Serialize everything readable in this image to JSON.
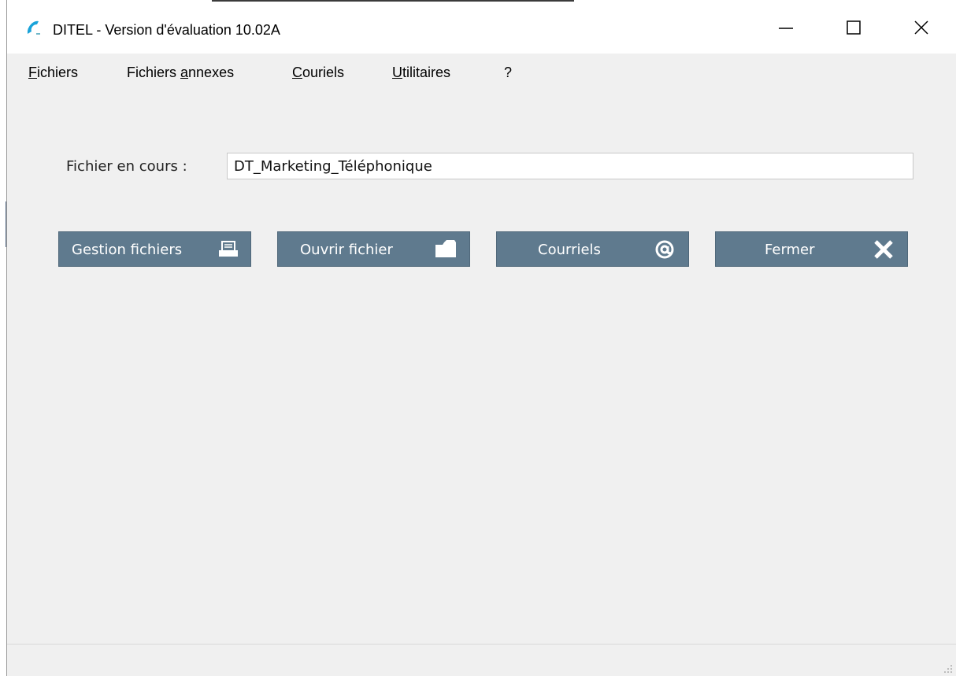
{
  "window": {
    "title": "DITEL - Version d'évaluation 10.02A",
    "app_icon": "phone-handset-icon",
    "controls": {
      "minimize_icon": "minimize-icon",
      "maximize_icon": "maximize-icon",
      "close_icon": "close-icon"
    }
  },
  "menubar": {
    "items": [
      {
        "mnemonic": "F",
        "rest": "ichiers",
        "prefix": ""
      },
      {
        "prefix": "Fichiers ",
        "mnemonic": "a",
        "rest": "nnexes"
      },
      {
        "prefix": "",
        "mnemonic": "C",
        "rest": "ouriels"
      },
      {
        "prefix": "",
        "mnemonic": "U",
        "rest": "tilitaires"
      },
      {
        "prefix": "?",
        "mnemonic": "",
        "rest": ""
      }
    ]
  },
  "current_file": {
    "label": "Fichier en cours :",
    "value": "DT_Marketing_Téléphonique"
  },
  "actions": {
    "gestion": {
      "label": "Gestion fichiers",
      "icon": "file-tray-icon"
    },
    "ouvrir": {
      "label": "Ouvrir fichier",
      "icon": "folder-icon"
    },
    "courriels": {
      "label": "Courriels",
      "icon": "at-sign-icon"
    },
    "fermer": {
      "label": "Fermer",
      "icon": "close-x-icon"
    }
  },
  "colors": {
    "button_bg": "#5f7a8e",
    "window_bg": "#f0f0f0",
    "accent_icon": "#1aa3d9"
  }
}
